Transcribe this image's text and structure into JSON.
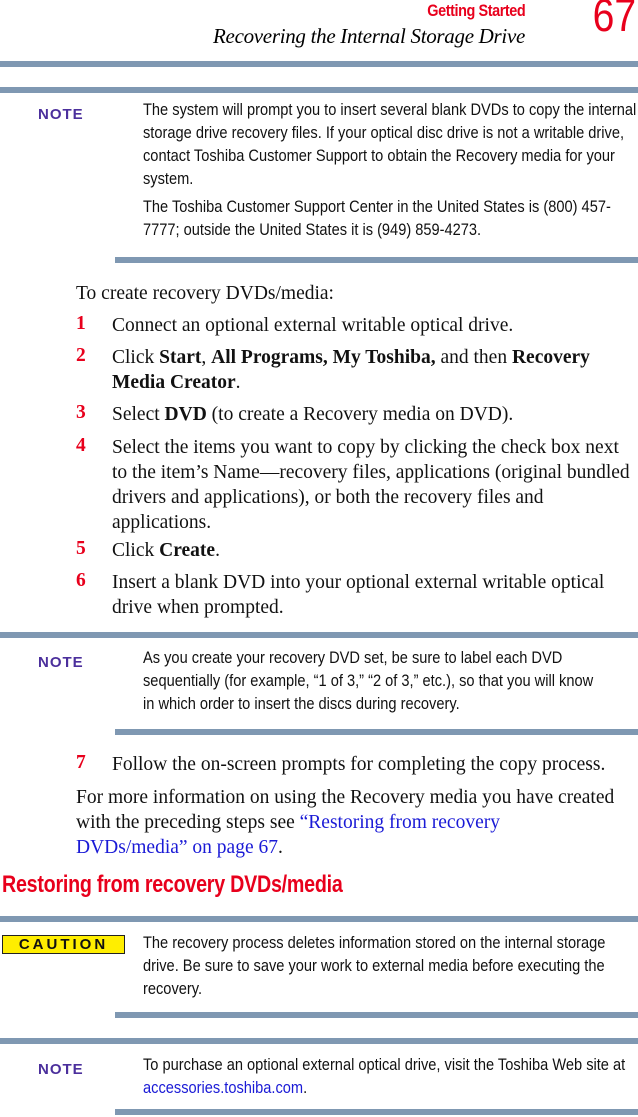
{
  "header": {
    "section": "Getting Started",
    "chapter": "Recovering the Internal Storage Drive",
    "page_number": "67"
  },
  "note1": {
    "label": "NOTE",
    "paragraphs": [
      "The system will prompt you to insert several blank DVDs to copy the internal storage drive recovery files. If your optical disc drive is not a writable drive, contact Toshiba Customer Support to obtain the Recovery media for your system.",
      "The Toshiba Customer Support Center in the United States is (800) 457-7777; outside the United States it is (949) 859-4273."
    ]
  },
  "intro": "To create recovery DVDs/media:",
  "steps": [
    {
      "num": "1",
      "text": "Connect an optional external writable optical drive."
    },
    {
      "num": "2",
      "pre": "Click ",
      "b1": "Start",
      "mid1": ", ",
      "b2": "All Programs, My Toshiba,",
      "mid2": " and then ",
      "b3": "Recovery Media Creator",
      "post": "."
    },
    {
      "num": "3",
      "pre": "Select ",
      "b1": "DVD",
      "post": " (to create a Recovery media on DVD)."
    },
    {
      "num": "4",
      "text": "Select the items you want to copy by clicking the check box next to the item’s Name—recovery files, applications (original bundled drivers and applications), or both the recovery files and applications."
    },
    {
      "num": "5",
      "pre": "Click ",
      "b1": "Create",
      "post": "."
    },
    {
      "num": "6",
      "text": "Insert a blank DVD into your optional external writable optical drive when prompted."
    },
    {
      "num": "7",
      "text": "Follow the on-screen prompts for completing the copy process."
    }
  ],
  "note2": {
    "label": "NOTE",
    "text": "As you create your recovery DVD set, be sure to label each DVD sequentially (for example, “1 of 3,” “2 of 3,” etc.), so that you will know in which order to insert the discs during recovery."
  },
  "more_info": {
    "pre": "For more information on using the Recovery media you have created with the preceding steps see ",
    "link": "“Restoring from recovery DVDs/media” on page 67",
    "post": "."
  },
  "section_title": "Restoring from recovery DVDs/media",
  "caution": {
    "label": "CAUTION",
    "text": "The recovery process deletes information stored on the internal storage drive. Be sure to save your work to external media before executing the recovery."
  },
  "note3": {
    "label": "NOTE",
    "pre": "To purchase an optional external optical drive, visit the Toshiba Web site at ",
    "link": "accessories.toshiba.com",
    "post": "."
  },
  "colors": {
    "accent_red": "#e8001c",
    "note_purple": "#4b2f9c",
    "rule_blue_gray": "#7f98b2",
    "caution_yellow": "#ffee00",
    "link_blue": "#1a1ad6"
  }
}
